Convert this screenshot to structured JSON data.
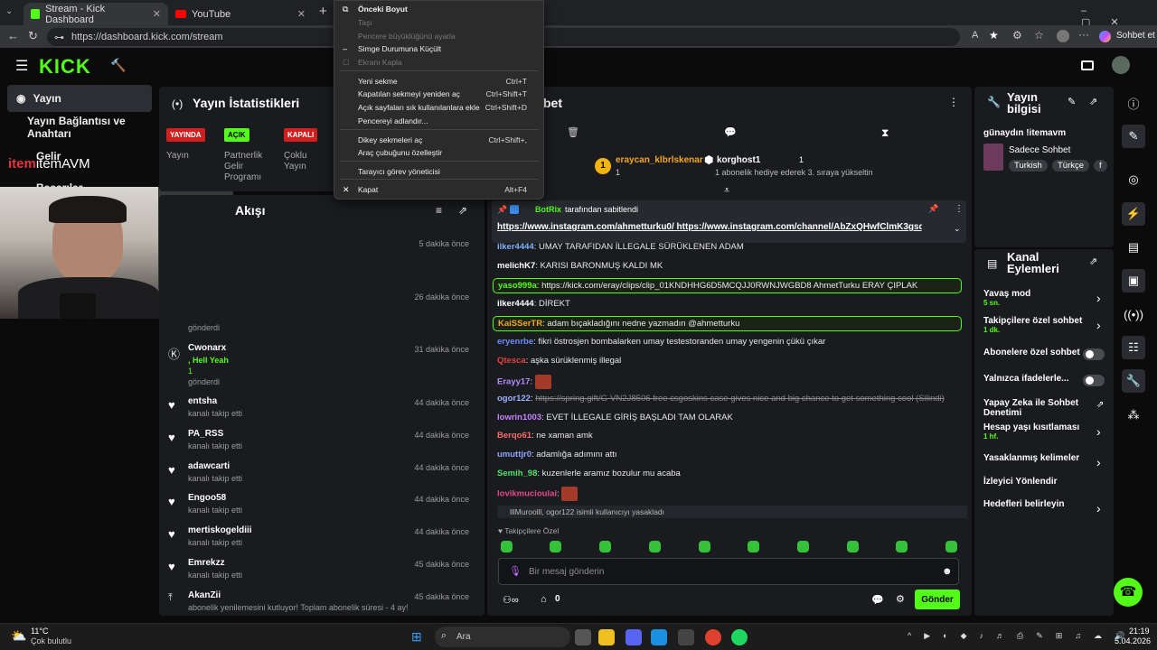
{
  "browser": {
    "tabs": [
      {
        "label": "Stream - Kick Dashboard"
      },
      {
        "label": "YouTube"
      }
    ],
    "url": "https://dashboard.kick.com/stream",
    "chat_with": "Sohbet et"
  },
  "context_menu": {
    "items": [
      {
        "label": "Önceki Boyut",
        "shortcut": "",
        "disabled": false
      },
      {
        "label": "Taşı",
        "shortcut": "",
        "disabled": true
      },
      {
        "label": "Pencere büyüklüğünü ayarla",
        "shortcut": "",
        "disabled": true
      },
      {
        "label": "Simge Durumuna Küçült",
        "shortcut": "",
        "disabled": false
      },
      {
        "label": "Ekranı Kapla",
        "shortcut": "",
        "disabled": true
      },
      {
        "label": "Yeni sekme",
        "shortcut": "Ctrl+T",
        "disabled": false
      },
      {
        "label": "Kapatılan sekmeyi yeniden aç",
        "shortcut": "Ctrl+Shift+T",
        "disabled": false
      },
      {
        "label": "Açık sayfaları sık kullanılanlara ekle",
        "shortcut": "Ctrl+Shift+D",
        "disabled": false
      },
      {
        "label": "Pencereyi adlandır...",
        "shortcut": "",
        "disabled": false
      },
      {
        "label": "Dikey sekmeleri aç",
        "shortcut": "Ctrl+Shift+,",
        "disabled": false
      },
      {
        "label": "Araç çubuğunu özelleştir",
        "shortcut": "",
        "disabled": false
      },
      {
        "label": "Tarayıcı görev yöneticisi",
        "shortcut": "",
        "disabled": false
      },
      {
        "label": "Kapat",
        "shortcut": "Alt+F4",
        "disabled": false
      }
    ]
  },
  "leftnav": {
    "items": [
      {
        "label": "Yayın"
      },
      {
        "label": "Yayın Bağlantısı ve Anahtarı"
      },
      {
        "label": "Gelir"
      },
      {
        "label": "Başarılar"
      }
    ],
    "overlay_logo": "itemAVM"
  },
  "stats": {
    "title": "Yayın İstatistikleri",
    "badges": [
      {
        "badge": "YAYINDA",
        "label": "Yayın",
        "color": "#e01b1b"
      },
      {
        "badge": "AÇIK",
        "label": "Partnerlik Gelir Programı",
        "color": "#53fc18"
      },
      {
        "badge": "KAPALI",
        "label": "Çoklu Yayın",
        "color": "#e01b1b"
      }
    ]
  },
  "activity": {
    "title": "Akışı",
    "rows": [
      {
        "name": "",
        "sub": "",
        "time": "5 dakika önce"
      },
      {
        "name": "",
        "sub": "",
        "time": "26 dakika önce"
      },
      {
        "name": "",
        "sub": "gönderdi",
        "time": ""
      },
      {
        "name": "Cwonarx",
        "sub": ", Hell Yeah",
        "extra": "1",
        "extra2": "gönderdi",
        "time": "31 dakika önce"
      },
      {
        "name": "entsha",
        "sub": "kanalı takip etti",
        "time": "44 dakika önce"
      },
      {
        "name": "PA_RSS",
        "sub": "kanalı takip etti",
        "time": "44 dakika önce"
      },
      {
        "name": "adawcarti",
        "sub": "kanalı takip etti",
        "time": "44 dakika önce"
      },
      {
        "name": "Engoo58",
        "sub": "kanalı takip etti",
        "time": "44 dakika önce"
      },
      {
        "name": "mertiskogeldiii",
        "sub": "kanalı takip etti",
        "time": "44 dakika önce"
      },
      {
        "name": "Emrekzz",
        "sub": "kanalı takip etti",
        "time": "45 dakika önce"
      },
      {
        "name": "AkanZii",
        "sub": "abonelik yenilemesini kutluyor! Toplam abonelik süresi - 4 ay!",
        "time": "45 dakika önce"
      }
    ]
  },
  "chat": {
    "title": "bet",
    "leaderboard": [
      {
        "rank": "1",
        "name": "eraycan_klbrlskenar",
        "count": "1"
      },
      {
        "name": "korghost1",
        "count": "1",
        "note": "1 abonelik hediye ederek 3. sıraya yükseltin"
      }
    ],
    "pinned": {
      "by": "BotRix",
      "label": "tarafından sabitlendi",
      "text": "https://www.instagram.com/ahmetturku0/ https://www.instagram.com/channel/AbZxQHwfClmK3gsq/"
    },
    "messages": [
      {
        "user": "ilker4444",
        "text": "UMAY TARAFIDAN İLLEGALE SÜRÜKLENEN ADAM",
        "color": "#7fb2ff"
      },
      {
        "user": "melichK7",
        "text": "KARISI BARONMUŞ KALDI MK",
        "color": "#fff"
      },
      {
        "user": "yaso999a",
        "text": "https://kick.com/eray/clips/clip_01KNDHHG6D5MCQJJ0RWNJWGBD8 AhmetTurku ERAY ÇIPLAK",
        "color": "#53fc18"
      },
      {
        "user": "ilker4444",
        "text": "DİREKT",
        "color": "#fff"
      },
      {
        "user": "KaiSSerTR",
        "text": "adam bıçakladığını nedne yazmadın @ahmetturku",
        "color": "#f5a623"
      },
      {
        "user": "eryenrbe",
        "text": "fikri östrosjen bombalarken umay testestoranden umay yengenin çükü çıkar",
        "color": "#6e8cff"
      },
      {
        "user": "Qtesca",
        "text": "aşka sürüklenmiş illegal",
        "color": "#e34242"
      },
      {
        "user": "Erayy17",
        "text": "",
        "color": "#b48cff"
      },
      {
        "user": "ogor122",
        "text": "https://spring.gift/G-VN2J8506 free csgoskins case gives nice and big chance to get something cool (Silindi)",
        "color": "#9bb1ff"
      },
      {
        "user": "lowrin1003",
        "text": "EVET İLLEGALE GİRİŞ BAŞLADI TAM OLARAK",
        "color": "#c882ff"
      },
      {
        "user": "Berqo61",
        "text": "ne xaman amk",
        "color": "#ff6a6a"
      },
      {
        "user": "umuttjr0",
        "text": "adamlığa adımını attı",
        "color": "#8fa5ff"
      },
      {
        "user": "Semih_98",
        "text": "kuzenlerle aramız bozulur mu acaba",
        "color": "#53e36a"
      },
      {
        "user": "lovikmucioulai",
        "text": "",
        "color": "#e34a8a"
      }
    ],
    "system": "lllMuroolll, ogor122 isimli kullanıcıyı yasakladı",
    "followers_only": "Takipçilere Özel",
    "input_placeholder": "Bir mesaj gönderin",
    "count": "0",
    "send": "Gönder"
  },
  "right": {
    "info_title": "Yayın bilgisi",
    "stream_title": "günaydın !itemavm",
    "category": "Sadece Sohbet",
    "tags": [
      "Turkish",
      "Türkçe",
      "f"
    ],
    "actions_title": "Kanal Eylemleri",
    "actions": [
      {
        "label": "Yavaş mod",
        "sub": "5 sn.",
        "kind": "chevron"
      },
      {
        "label": "Takipçilere özel sohbet",
        "sub": "1 dk.",
        "kind": "chevron"
      },
      {
        "label": "Abonelere özel sohbet",
        "sub": "",
        "kind": "toggle"
      },
      {
        "label": "Yalnızca ifadelerle...",
        "sub": "",
        "kind": "toggle"
      },
      {
        "label": "Yapay Zeka ile Sohbet Denetimi",
        "sub": "",
        "kind": "link"
      },
      {
        "label": "Hesap yaşı kısıtlaması",
        "sub": "1 hf.",
        "kind": "chevron"
      },
      {
        "label": "Yasaklanmış kelimeler",
        "sub": "",
        "kind": "chevron"
      },
      {
        "label": "İzleyici Yönlendir",
        "sub": "",
        "kind": "none"
      },
      {
        "label": "Hedefleri belirleyin",
        "sub": "",
        "kind": "chevron"
      }
    ]
  },
  "taskbar": {
    "weather_temp": "11°C",
    "weather_text": "Çok bulutlu",
    "search": "Ara",
    "time": "21:19",
    "date": "5.04.2026"
  }
}
